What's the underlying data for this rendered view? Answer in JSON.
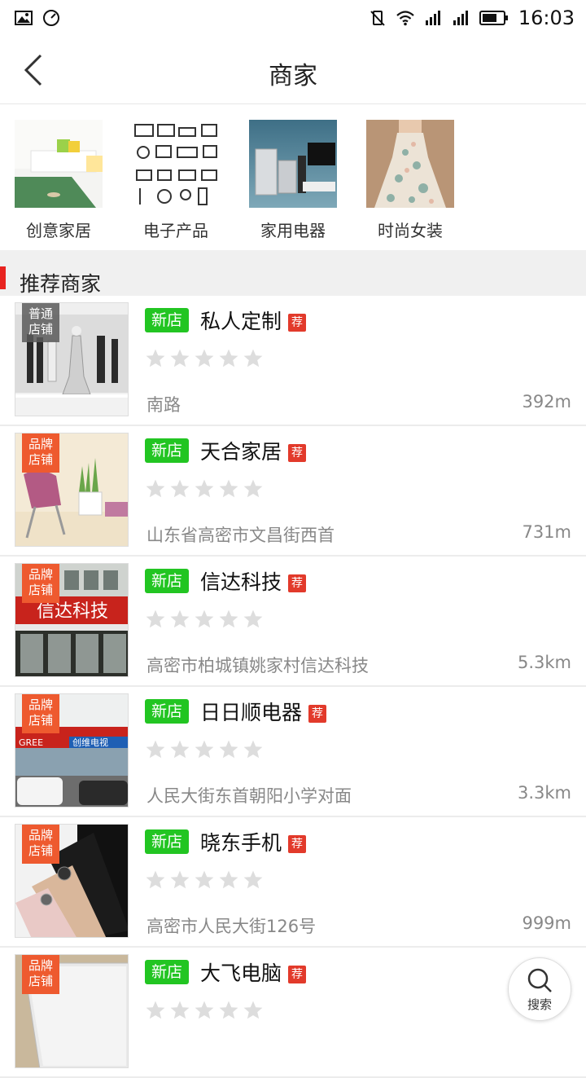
{
  "status_bar": {
    "time": "16:03",
    "left_icons": [
      "image-icon",
      "speedometer-icon"
    ],
    "right_icons": [
      "vibrate-icon",
      "wifi-icon",
      "signal-icon",
      "signal-icon",
      "battery-icon"
    ]
  },
  "header": {
    "title": "商家",
    "back_icon": "back-arrow-icon"
  },
  "categories": [
    {
      "label": "创意家居"
    },
    {
      "label": "电子产品"
    },
    {
      "label": "家用电器"
    },
    {
      "label": "时尚女装"
    }
  ],
  "section": {
    "title": "推荐商家",
    "accent_color": "#e8231f"
  },
  "tags": {
    "new": "新店",
    "recommend": "荐"
  },
  "stores": [
    {
      "badge": "普通\n店铺",
      "badge_type": "normal",
      "name": "私人定制",
      "rating": 0,
      "address": "南路",
      "distance": "392m"
    },
    {
      "badge": "品牌\n店铺",
      "badge_type": "brand",
      "name": "天合家居",
      "rating": 0,
      "address": "山东省高密市文昌街西首",
      "distance": "731m"
    },
    {
      "badge": "品牌\n店铺",
      "badge_type": "brand",
      "name": "信达科技",
      "rating": 0,
      "address": "高密市柏城镇姚家村信达科技",
      "distance": "5.3km",
      "sign_text": "信达科技"
    },
    {
      "badge": "品牌\n店铺",
      "badge_type": "brand",
      "name": "日日顺电器",
      "rating": 0,
      "address": "人民大街东首朝阳小学对面",
      "distance": "3.3km",
      "sign_text": "GREE",
      "sign_text2": "创维电视"
    },
    {
      "badge": "品牌\n店铺",
      "badge_type": "brand",
      "name": "晓东手机",
      "rating": 0,
      "address": "高密市人民大街126号",
      "distance": "999m"
    },
    {
      "badge": "品牌\n店铺",
      "badge_type": "brand",
      "name": "大飞电脑",
      "rating": 0,
      "address": "",
      "distance": ""
    }
  ],
  "fab": {
    "label": "搜索",
    "icon": "search-icon"
  },
  "colors": {
    "new_tag": "#22c522",
    "recommend_tag": "#e23a2b",
    "brand_badge": "#ee5a2f",
    "star_empty": "#dddddd"
  }
}
